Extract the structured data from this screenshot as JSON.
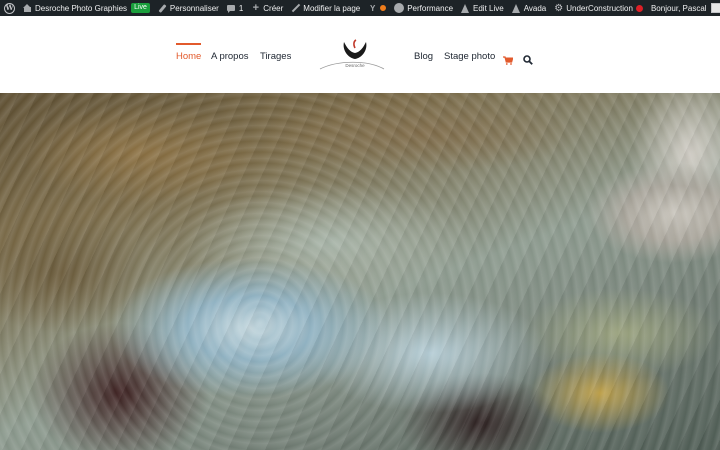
{
  "adminbar": {
    "site_name": "Desroche Photo Graphies",
    "live_badge": "Live",
    "customize": "Personnaliser",
    "comments_count": "1",
    "new": "Créer",
    "edit_page": "Modifier la page",
    "performance": "Performance",
    "edit_live": "Edit Live",
    "avada": "Avada",
    "under_construction": "UnderConstruction",
    "greeting": "Bonjour, Pascal",
    "colors": {
      "bar": "#1d2327",
      "live": "#1a9f3c",
      "status_orange": "#ee7c1b",
      "status_red": "#dd1f26"
    }
  },
  "nav": {
    "home": "Home",
    "about": "A propos",
    "prints": "Tirages",
    "blog": "Blog",
    "workshop": "Stage photo",
    "accent": "#e25a2c"
  },
  "logo": {
    "text": "Desroche"
  },
  "hero": {
    "description_icon": "water-over-rocks-photo"
  }
}
